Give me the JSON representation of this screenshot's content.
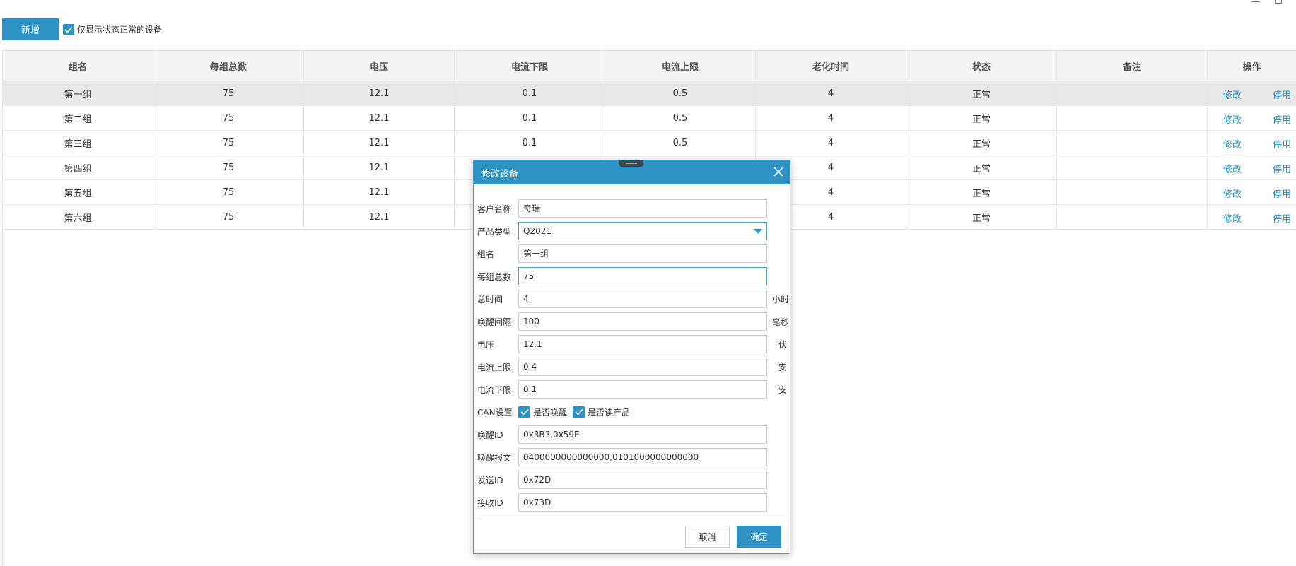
{
  "toolbar": {
    "add_label": "新增",
    "filter_label": "仅显示状态正常的设备",
    "filter_checked": true
  },
  "table": {
    "headers": [
      "组名",
      "每组总数",
      "电压",
      "电流下限",
      "电流上限",
      "老化时间",
      "状态",
      "备注",
      "操作"
    ],
    "rows": [
      {
        "name": "第一组",
        "total": "75",
        "voltage": "12.1",
        "cur_min": "0.1",
        "cur_max": "0.5",
        "aging": "4",
        "status": "正常",
        "remark": ""
      },
      {
        "name": "第二组",
        "total": "75",
        "voltage": "12.1",
        "cur_min": "0.1",
        "cur_max": "0.5",
        "aging": "4",
        "status": "正常",
        "remark": ""
      },
      {
        "name": "第三组",
        "total": "75",
        "voltage": "12.1",
        "cur_min": "0.1",
        "cur_max": "0.5",
        "aging": "4",
        "status": "正常",
        "remark": ""
      },
      {
        "name": "第四组",
        "total": "75",
        "voltage": "12.1",
        "cur_min": "",
        "cur_max": "",
        "aging": "4",
        "status": "正常",
        "remark": ""
      },
      {
        "name": "第五组",
        "total": "75",
        "voltage": "12.1",
        "cur_min": "",
        "cur_max": "",
        "aging": "4",
        "status": "正常",
        "remark": ""
      },
      {
        "name": "第六组",
        "total": "75",
        "voltage": "12.1",
        "cur_min": "",
        "cur_max": "",
        "aging": "4",
        "status": "正常",
        "remark": ""
      }
    ],
    "edit_label": "修改",
    "disable_label": "停用"
  },
  "dialog": {
    "title": "修改设备",
    "fields": {
      "customer": {
        "label": "客户名称",
        "value": "奇瑞"
      },
      "product_type": {
        "label": "产品类型",
        "value": "Q2021"
      },
      "group_name": {
        "label": "组名",
        "value": "第一组"
      },
      "group_total": {
        "label": "每组总数",
        "value": "75"
      },
      "total_time": {
        "label": "总时间",
        "value": "4",
        "unit": "小时"
      },
      "wake_interval": {
        "label": "唤醒间隔",
        "value": "100",
        "unit": "毫秒"
      },
      "voltage": {
        "label": "电压",
        "value": "12.1",
        "unit": "伏"
      },
      "current_max": {
        "label": "电流上限",
        "value": "0.4",
        "unit": "安"
      },
      "current_min": {
        "label": "电流下限",
        "value": "0.1",
        "unit": "安"
      },
      "can": {
        "label": "CAN设置",
        "opt_wake": "是否唤醒",
        "opt_read": "是否读产品"
      },
      "wake_id": {
        "label": "唤醒ID",
        "value": "0x3B3,0x59E"
      },
      "wake_msg": {
        "label": "唤醒报文",
        "value": "0400000000000000,0101000000000000"
      },
      "send_id": {
        "label": "发送ID",
        "value": "0x72D"
      },
      "recv_id": {
        "label": "接收ID",
        "value": "0x73D"
      }
    },
    "cancel_label": "取消",
    "ok_label": "确定"
  },
  "colors": {
    "accent": "#2e93c4",
    "selected_row": "#e8e8e8",
    "header_bg": "#f4f4f4"
  }
}
